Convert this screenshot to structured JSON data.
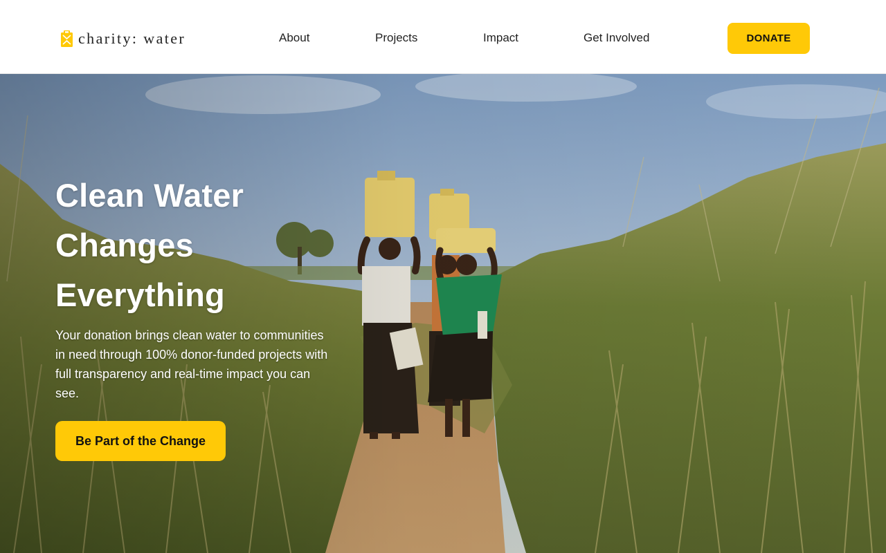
{
  "brand": {
    "name": "charity: water",
    "accent_color": "#FFC907",
    "logo_icon": "jerry-can-icon"
  },
  "nav": {
    "links": [
      {
        "label": "About"
      },
      {
        "label": "Projects"
      },
      {
        "label": "Impact"
      },
      {
        "label": "Get Involved"
      }
    ],
    "donate_label": "DONATE"
  },
  "hero": {
    "title_lines": [
      "Clean Water",
      "Changes",
      "Everything"
    ],
    "subtitle": "Your donation brings clean water to communities in need through 100% donor-funded projects with full transparency and real-time impact you can see.",
    "cta_label": "Be Part of the Change"
  }
}
